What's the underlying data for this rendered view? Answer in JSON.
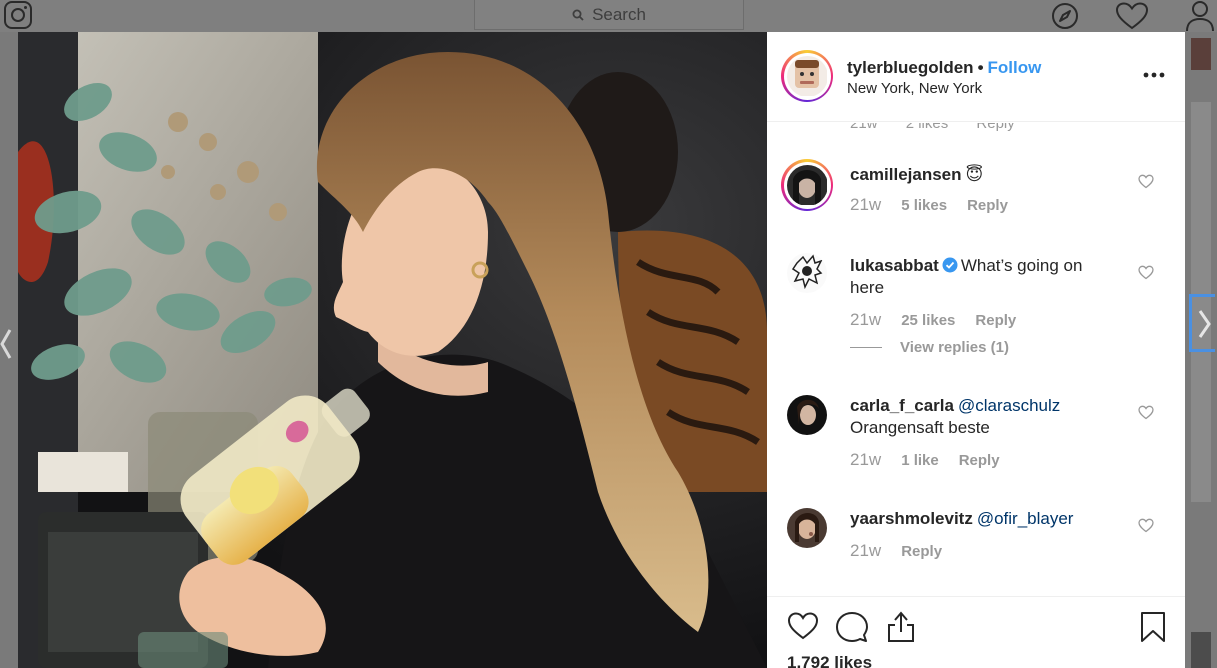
{
  "nav": {
    "search_placeholder": "Search"
  },
  "post": {
    "username": "tylerbluegolden",
    "separator": "•",
    "follow_label": "Follow",
    "location": "New York, New York",
    "likes_label": "1,792 likes"
  },
  "partial_comment": {
    "time": "21w",
    "likes": "2 likes",
    "reply": "Reply"
  },
  "comments": [
    {
      "username": "camillejansen",
      "text": "😇",
      "time": "21w",
      "likes": "5 likes",
      "reply": "Reply"
    },
    {
      "username": "lukasabbat",
      "verified": true,
      "text": "What’s going on here",
      "time": "21w",
      "likes": "25 likes",
      "reply": "Reply",
      "view_replies": "View replies (1)"
    },
    {
      "username": "carla_f_carla",
      "mention": "@claraschulz",
      "text": "Orangensaft beste",
      "time": "21w",
      "likes": "1 like",
      "reply": "Reply"
    },
    {
      "username": "yaarshmolevitz",
      "mention": "@ofir_blayer",
      "time": "21w",
      "reply": "Reply"
    }
  ],
  "colors": {
    "link_blue": "#3897f0",
    "mention_blue": "#003569",
    "muted_gray": "#999999",
    "overlay_gray": "#7f7f7f"
  }
}
